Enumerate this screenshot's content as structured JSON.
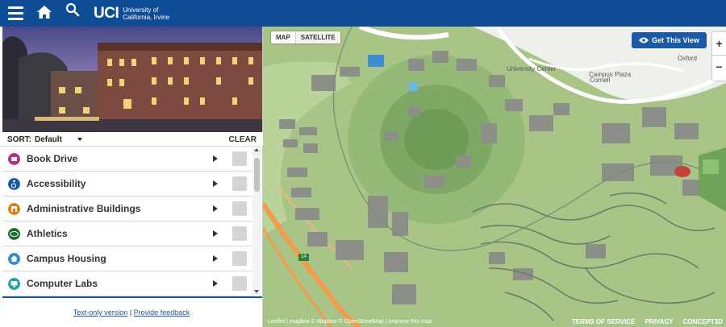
{
  "header": {
    "logo_mark": "UCI",
    "logo_line1": "University of",
    "logo_line2": "California, Irvine"
  },
  "sidebar": {
    "sort_label": "SORT:",
    "sort_value": "Default",
    "clear_label": "CLEAR",
    "categories": [
      {
        "label": "Book Drive",
        "icon": "book-drive-icon",
        "color": "#b42a8e"
      },
      {
        "label": "Accessibility",
        "icon": "accessibility-icon",
        "color": "#1a5aa5"
      },
      {
        "label": "Administrative Buildings",
        "icon": "admin-building-icon",
        "color": "#e07b12"
      },
      {
        "label": "Athletics",
        "icon": "athletics-icon",
        "color": "#1f6b2a"
      },
      {
        "label": "Campus Housing",
        "icon": "housing-icon",
        "color": "#2a8ad4"
      },
      {
        "label": "Computer Labs",
        "icon": "computer-icon",
        "color": "#1aa3a3"
      }
    ],
    "footer_text_only": "Text-only version",
    "footer_sep": "|",
    "footer_feedback": "Provide feedback"
  },
  "map": {
    "toggle_map": "MAP",
    "toggle_satellite": "SATELLITE",
    "get_view": "Get This View",
    "zoom_in": "+",
    "zoom_out": "−",
    "labels": {
      "university_center": "University Center",
      "campus_plaza": "Campus Plaza",
      "cornell": "Cornell",
      "oxford": "Oxford",
      "shield": "14"
    },
    "attribution": "Leaflet | mapbox © Mapbox © OpenStreetMap | Improve this map",
    "footer_links": [
      "TERMS OF SERVICE",
      "PRIVACY",
      "CONCEPT3D"
    ]
  },
  "colors": {
    "brand_blue": "#0e4c96",
    "link_blue": "#1a5aa5"
  }
}
